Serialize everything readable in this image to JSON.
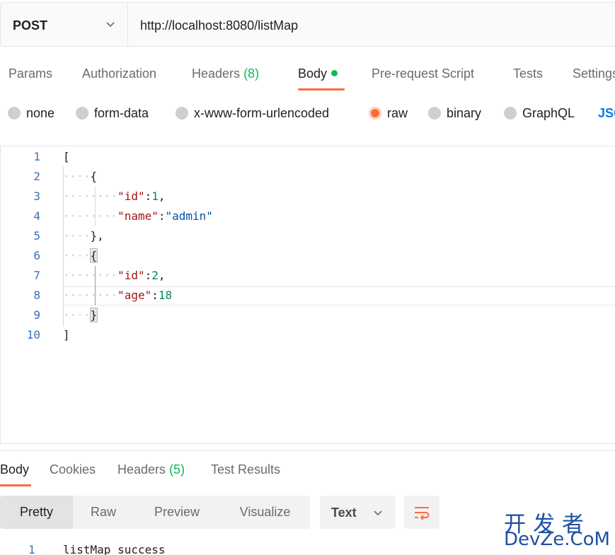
{
  "request": {
    "method": "POST",
    "url": "http://localhost:8080/listMap"
  },
  "tabs": {
    "params": "Params",
    "authorization": "Authorization",
    "headers_label": "Headers",
    "headers_count": "(8)",
    "body": "Body",
    "prerequest": "Pre-request Script",
    "tests": "Tests",
    "settings": "Settings"
  },
  "body_types": {
    "none": "none",
    "form_data": "form-data",
    "urlencoded": "x-www-form-urlencoded",
    "raw": "raw",
    "binary": "binary",
    "graphql": "GraphQL",
    "json": "JSON",
    "selected": "raw"
  },
  "editor": {
    "line_numbers": [
      "1",
      "2",
      "3",
      "4",
      "5",
      "6",
      "7",
      "8",
      "9",
      "10"
    ],
    "l1": "[",
    "l2_brace": "{",
    "l3_key": "\"id\"",
    "l3_colon": ":",
    "l3_val": "1",
    "l3_comma": ",",
    "l4_key": "\"name\"",
    "l4_colon": ":",
    "l4_val": "\"admin\"",
    "l5_brace": "}",
    "l5_comma": ",",
    "l6_brace": "{",
    "l7_key": "\"id\"",
    "l7_colon": ":",
    "l7_val": "2",
    "l7_comma": ",",
    "l8_key": "\"age\"",
    "l8_colon": ":",
    "l8_val": "18",
    "l9_brace": "}",
    "l10": "]"
  },
  "response": {
    "tabs": {
      "body": "Body",
      "cookies": "Cookies",
      "headers_label": "Headers",
      "headers_count": "(5)",
      "test_results": "Test Results"
    },
    "views": [
      "Pretty",
      "Raw",
      "Preview",
      "Visualize"
    ],
    "format": "Text",
    "line_number": "1",
    "text": "listMap success"
  },
  "watermark": {
    "cn": "开发者",
    "en": "DevZe.CoM"
  },
  "colors": {
    "accent": "#ff6c37",
    "success": "#0cbb52",
    "link": "#097bed"
  }
}
